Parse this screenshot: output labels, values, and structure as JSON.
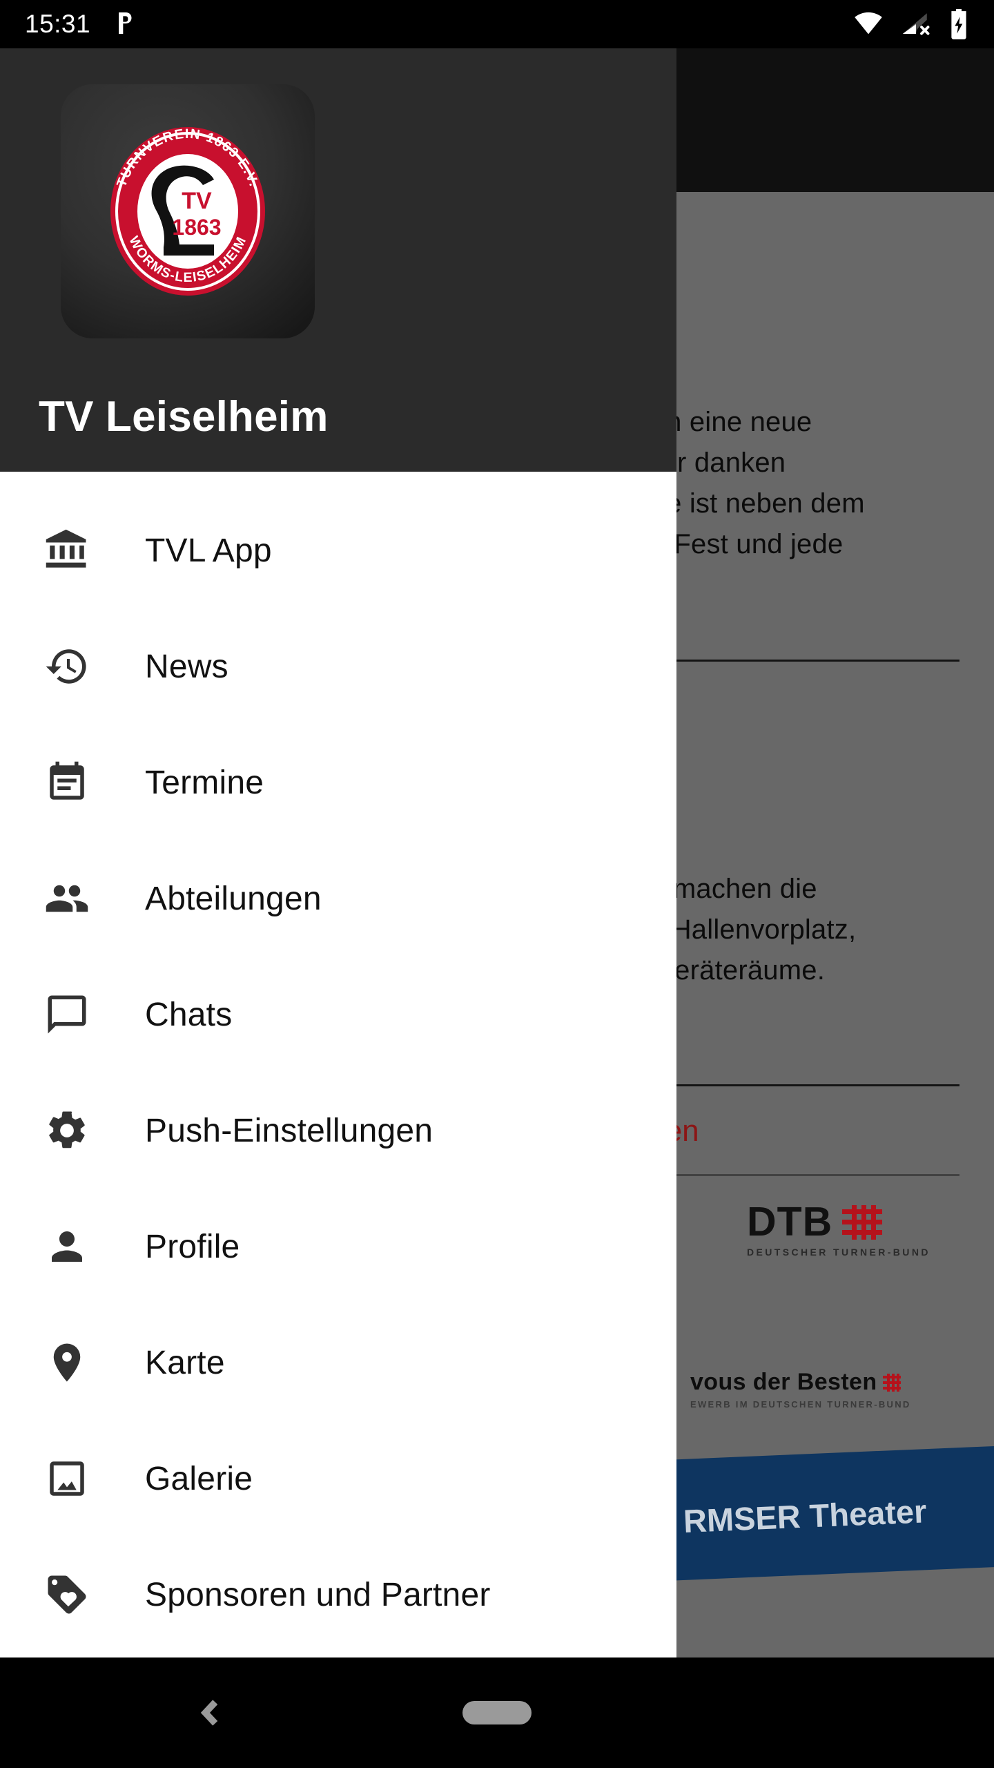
{
  "status_bar": {
    "time": "15:31",
    "left_icons": [
      "parking-p-icon"
    ],
    "right_icons": [
      "wifi-icon",
      "cellular-no-sim-icon",
      "battery-charging-icon"
    ]
  },
  "drawer": {
    "title": "TV Leiselheim",
    "logo": {
      "icon": "club-crest-logo",
      "arc_top_text": "TURNVEREIN 1863 E.V.",
      "arc_bottom_text": "WORMS-LEISELHEIM",
      "center_line_1": "TV",
      "center_line_2": "1863",
      "ring_color": "#c8102e",
      "tile_color": "#303030"
    },
    "items": [
      {
        "label": "TVL App",
        "icon": "account-balance-icon"
      },
      {
        "label": "News",
        "icon": "history-icon"
      },
      {
        "label": "Termine",
        "icon": "event-note-icon"
      },
      {
        "label": "Abteilungen",
        "icon": "people-icon"
      },
      {
        "label": "Chats",
        "icon": "chat-bubble-icon"
      },
      {
        "label": "Push-Einstellungen",
        "icon": "settings-gear-icon"
      },
      {
        "label": "Profile",
        "icon": "person-icon"
      },
      {
        "label": "Karte",
        "icon": "location-pin-icon"
      },
      {
        "label": "Galerie",
        "icon": "image-icon"
      },
      {
        "label": "Sponsoren und Partner",
        "icon": "loyalty-tag-icon"
      }
    ]
  },
  "background": {
    "paragraph_1": "auch eine neue\nt. Wir danken\nüche ist neben dem\ndes Fest und jede",
    "paragraph_2": "Wir machen die\nder Hallenvorplatz,\nie Geräteräume.",
    "heading_red": "esten",
    "dtb": {
      "word": "DTB",
      "subtitle": "DEUTSCHER TURNER-BUND",
      "mark_color": "#b5121b"
    },
    "rendezvous": {
      "word": "vous der Besten",
      "subtitle": "EWERB IM DEUTSCHEN TURNER-BUND"
    },
    "theater_banner": {
      "text": "RMSER Theater",
      "background_color": "#0e3560"
    }
  },
  "nav_bar": {
    "back_icon": "chevron-left-icon",
    "home_indicator": "home-pill-icon"
  }
}
